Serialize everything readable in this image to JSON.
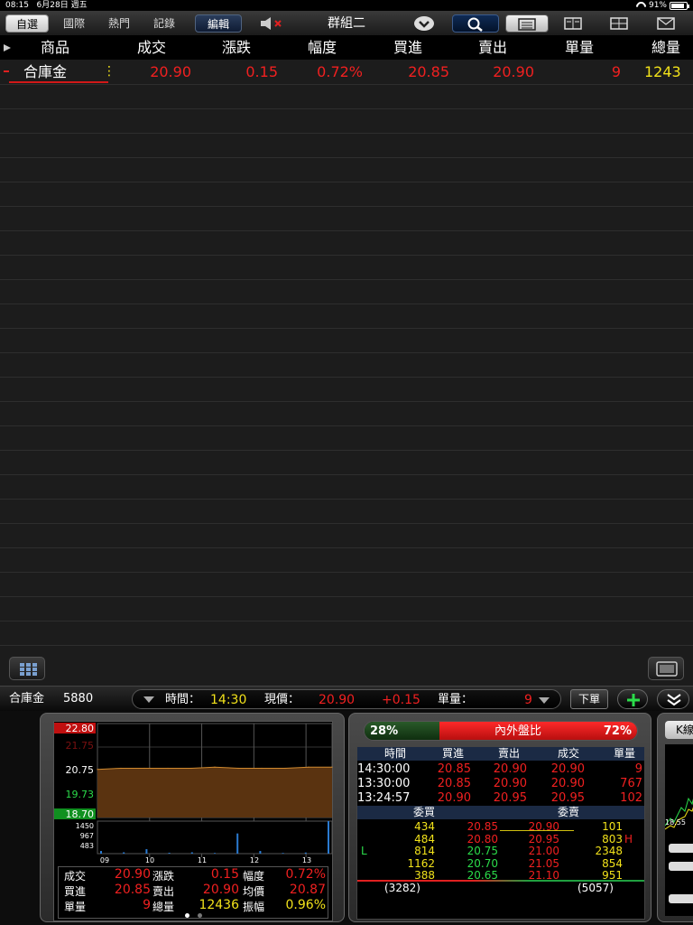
{
  "status": {
    "time": "08:15",
    "date": "6月28日 週五",
    "battery": "91%"
  },
  "toolbar": {
    "tabs": [
      {
        "label": "自選",
        "active": true
      },
      {
        "label": "國際",
        "active": false
      },
      {
        "label": "熱門",
        "active": false
      },
      {
        "label": "記錄",
        "active": false
      }
    ],
    "edit_label": "編輯",
    "group_title": "群組二"
  },
  "table": {
    "headers": [
      "商品",
      "成交",
      "漲跌",
      "幅度",
      "買進",
      "賣出",
      "單量",
      "總量"
    ],
    "rows": [
      {
        "name": "合庫金",
        "price": "20.90",
        "change": "0.15",
        "pct": "0.72%",
        "bid": "20.85",
        "ask": "20.90",
        "qty": "9",
        "total": "1243"
      }
    ]
  },
  "detail": {
    "name": "合庫金",
    "code": "5880",
    "time_label": "時間：",
    "time": "14:30",
    "price_label": "現價：",
    "price": "20.90",
    "change": "+0.15",
    "qty_label": "單量：",
    "qty": "9",
    "order_button": "下單"
  },
  "chart_panel": {
    "ylabels": [
      "22.80",
      "21.75",
      "20.75",
      "19.73",
      "18.70"
    ],
    "vol_labels": [
      "1450",
      "967",
      "483"
    ],
    "xlabels": [
      "09",
      "10",
      "11",
      "12",
      "13"
    ],
    "stats": [
      [
        {
          "k": "成交",
          "v": "20.90"
        },
        {
          "k": "漲跌",
          "v": "0.15"
        },
        {
          "k": "幅度",
          "v": "0.72%"
        }
      ],
      [
        {
          "k": "買進",
          "v": "20.85"
        },
        {
          "k": "賣出",
          "v": "20.90"
        },
        {
          "k": "均價",
          "v": "20.87"
        }
      ],
      [
        {
          "k": "單量",
          "v": "9"
        },
        {
          "k": "總量",
          "v": "12436"
        },
        {
          "k": "振幅",
          "v": "0.96%"
        }
      ]
    ]
  },
  "chart_data": {
    "type": "area",
    "title": "",
    "xlabel": "",
    "ylabel": "",
    "x": [
      "09",
      "10",
      "11",
      "12",
      "13"
    ],
    "ylim": [
      18.7,
      22.8
    ],
    "series": [
      {
        "values": [
          20.8,
          20.85,
          20.85,
          20.85,
          20.85,
          20.9,
          20.85,
          20.85,
          20.85,
          20.9,
          20.9
        ]
      }
    ],
    "volume": {
      "ylim": [
        0,
        1450
      ],
      "values": [
        120,
        60,
        200,
        40,
        60,
        30,
        900,
        120,
        30,
        50,
        1450
      ]
    }
  },
  "book_panel": {
    "bar": {
      "inner_pct": "28%",
      "title": "內外盤比",
      "outer_pct": "72%",
      "inner_ratio": 0.28
    },
    "tick_headers": [
      "時間",
      "買進",
      "賣出",
      "成交",
      "單量"
    ],
    "ticks": [
      [
        "14:30:00",
        "20.85",
        "20.90",
        "20.90",
        "9"
      ],
      [
        "13:30:00",
        "20.85",
        "20.90",
        "20.90",
        "767"
      ],
      [
        "13:24:57",
        "20.90",
        "20.95",
        "20.95",
        "102"
      ]
    ],
    "book_headers": [
      "委買",
      "委賣"
    ],
    "book": [
      {
        "bq": "434",
        "bp": "20.85",
        "ap": "20.90",
        "aq": "101",
        "flag": ""
      },
      {
        "bq": "484",
        "bp": "20.80",
        "ap": "20.95",
        "aq": "803",
        "flag": "H"
      },
      {
        "bq": "814",
        "bp": "20.75",
        "ap": "21.00",
        "aq": "2348",
        "flag": "L"
      },
      {
        "bq": "1162",
        "bp": "20.70",
        "ap": "21.05",
        "aq": "854",
        "flag": ""
      },
      {
        "bq": "388",
        "bp": "20.65",
        "ap": "21.10",
        "aq": "951",
        "flag": ""
      }
    ],
    "totals": [
      "(3282)",
      "(5057)"
    ]
  },
  "right_panel": {
    "k_label": "K線",
    "val": "18.55"
  }
}
